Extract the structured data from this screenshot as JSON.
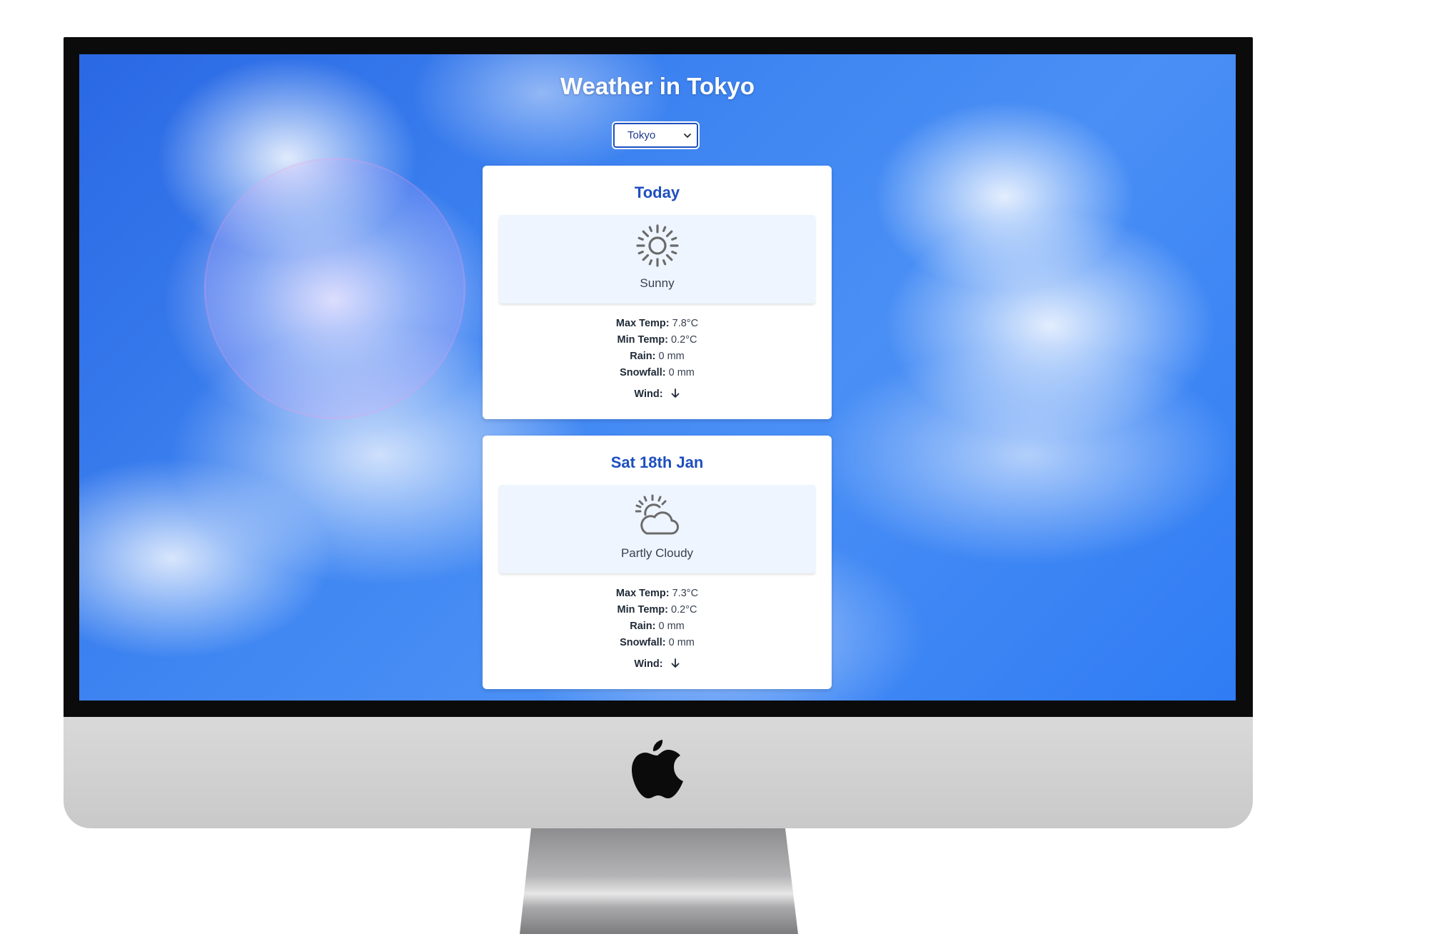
{
  "page": {
    "title": "Weather in Tokyo"
  },
  "city_select": {
    "selected": "Tokyo"
  },
  "colors": {
    "accent": "#1e4fbf",
    "sky": "#3f86f2",
    "card_bg": "#ffffff",
    "condition_bg": "#eff5fe"
  },
  "forecast": [
    {
      "day": "Today",
      "condition": "Sunny",
      "icon": "sun-icon",
      "max_temp_label": "Max Temp:",
      "max_temp": "7.8°C",
      "min_temp_label": "Min Temp:",
      "min_temp": "0.2°C",
      "rain_label": "Rain:",
      "rain": "0 mm",
      "snowfall_label": "Snowfall:",
      "snowfall": "0 mm",
      "wind_label": "Wind:",
      "wind_icon": "arrow-down-icon"
    },
    {
      "day": "Sat 18th Jan",
      "condition": "Partly Cloudy",
      "icon": "partly-cloudy-icon",
      "max_temp_label": "Max Temp:",
      "max_temp": "7.3°C",
      "min_temp_label": "Min Temp:",
      "min_temp": "0.2°C",
      "rain_label": "Rain:",
      "rain": "0 mm",
      "snowfall_label": "Snowfall:",
      "snowfall": "0 mm",
      "wind_label": "Wind:",
      "wind_icon": "arrow-down-icon"
    }
  ]
}
